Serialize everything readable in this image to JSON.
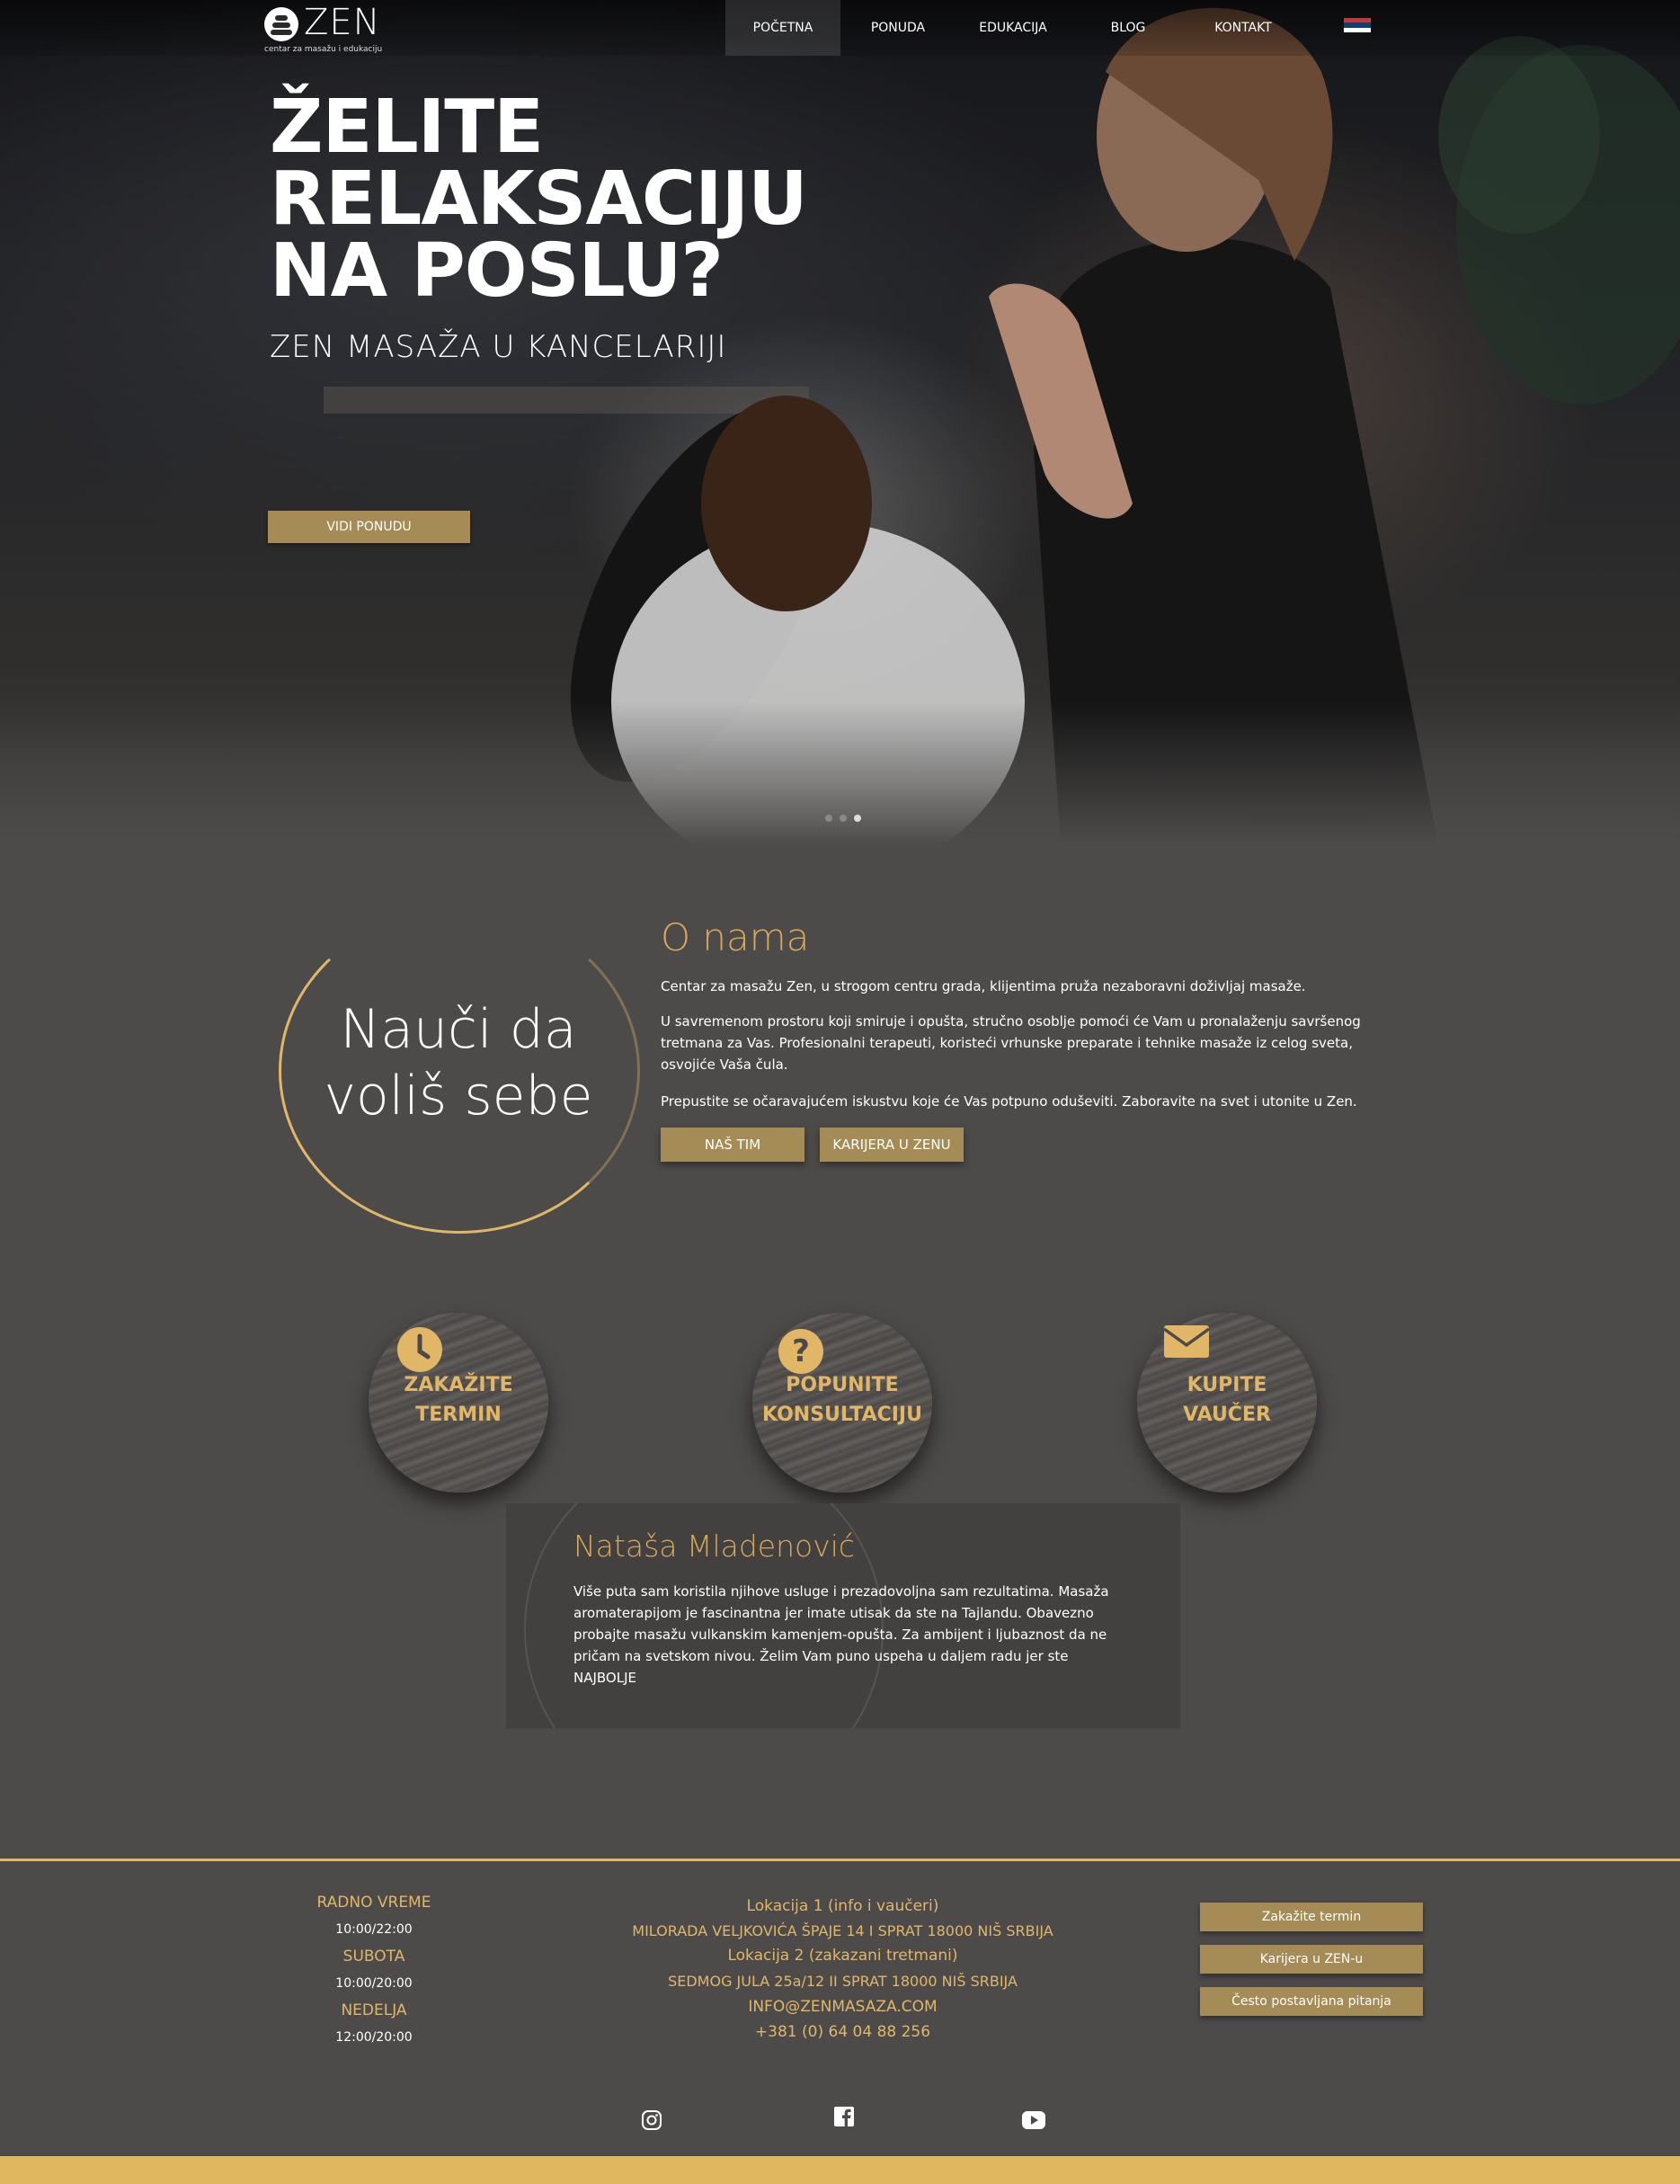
{
  "header": {
    "logo_text": "ZEN",
    "logo_tagline": "centar za masažu i edukaciju",
    "nav": [
      "POČETNA",
      "PONUDA",
      "EDUKACIJA",
      "BLOG",
      "KONTAKT"
    ],
    "active_nav": "POČETNA",
    "language_flag": "serbia-flag-icon"
  },
  "hero": {
    "title_lines": [
      "ŽELITE",
      "RELAKSACIJU",
      "NA POSLU?"
    ],
    "subtitle": "ZEN MASAŽA U KANCELARIJI",
    "cta": "VIDI PONUDU",
    "slide_count": 3,
    "active_slide": 3
  },
  "about": {
    "circle_lines": [
      "Nauči da",
      "voliš sebe"
    ],
    "title": "O nama",
    "paragraphs": [
      "Centar za masažu Zen, u strogom centru grada, klijentima pruža nezaboravni doživljaj masaže.",
      "U savremenom prostoru koji smiruje i opušta, stručno osoblje pomoći će Vam u pronalaženju savršenog tretmana za Vas. Profesionalni terapeuti, koristeći vrhunske preparate i tehnike masaže iz celog sveta, osvojiće Vaša čula.",
      "Prepustite se očaravajućem iskustvu koje će Vas potpuno oduševiti. Zaboravite na svet i utonite u Zen."
    ],
    "buttons": [
      "NAŠ TIM",
      "KARIJERA U ZENU"
    ]
  },
  "features": [
    {
      "lines": [
        "ZAKAŽITE",
        "TERMIN"
      ],
      "icon": "clock-icon"
    },
    {
      "lines": [
        "POPUNITE",
        "KONSULTACIJU"
      ],
      "icon": "question-icon"
    },
    {
      "lines": [
        "KUPITE",
        "VAUČER"
      ],
      "icon": "envelope-icon"
    }
  ],
  "testimonial": {
    "name": "Nataša Mladenović",
    "text": "Više puta sam koristila njihove usluge i prezadovoljna sam rezultatima. Masaža aromaterapijom je fascinantna jer imate utisak da ste na Tajlandu. Obavezno probajte masažu vulkanskim kamenjem-opušta. Za ambijent i ljubaznost da ne pričam na svetskom nivou. Želim Vam puno uspeha u daljem radu jer ste NAJBOLJE"
  },
  "footer": {
    "hours": [
      {
        "label": "RADNO VREME",
        "time": "10:00/22:00"
      },
      {
        "label": "SUBOTA",
        "time": "10:00/20:00"
      },
      {
        "label": "NEDELJA",
        "time": "12:00/20:00"
      }
    ],
    "location1_title": "Lokacija 1 (info i vaučeri)",
    "location1_address": "MILORADA VELJKOVIĆA ŠPAJE 14 I SPRAT 18000 NIŠ SRBIJA",
    "location2_title": "Lokacija 2 (zakazani tretmani)",
    "location2_address": "SEDMOG JULA 25a/12 II SPRAT 18000 NIŠ SRBIJA",
    "email": "INFO@ZENMASAZA.COM",
    "phone": "+381 (0) 64 04 88 256",
    "links": [
      "Zakažite termin",
      "Karijera u ZEN-u",
      "Često postavljana pitanja"
    ],
    "social": [
      "instagram-icon",
      "facebook-icon",
      "youtube-icon"
    ]
  },
  "colors": {
    "gold": "#e2b667",
    "button_gold": "#a58b55",
    "background": "#4d4b4a"
  }
}
